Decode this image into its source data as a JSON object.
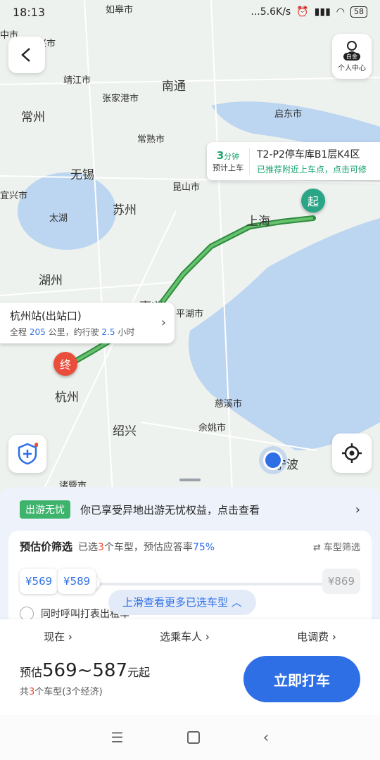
{
  "status": {
    "time": "18:13",
    "network": "...5.6K/s",
    "battery": "58"
  },
  "header": {
    "back_label": "<",
    "profile_badge": "白金",
    "profile_label": "个人中心"
  },
  "map": {
    "labels": [
      "如皋市",
      "中市",
      "泰兴市",
      "靖江市",
      "南通",
      "张家港市",
      "常州",
      "常熟市",
      "启东市",
      "无锡",
      "宜兴市",
      "昆山市",
      "苏州",
      "太湖",
      "上海",
      "湖州",
      "嘉兴",
      "平湖市",
      "杭州",
      "绍兴",
      "慈溪市",
      "余姚市",
      "诸暨市",
      "宁波"
    ],
    "start_marker": "起",
    "end_marker": "终"
  },
  "pickup": {
    "minutes": "3",
    "minutes_unit": "分钟",
    "eta_label": "预计上车",
    "location": "T2-P2停车库B1层K4区",
    "hint": "已推荐附近上车点，点击可修"
  },
  "destination": {
    "name": "杭州站(出站口)",
    "prefix": "全程",
    "distance": "205",
    "mid": "公里，约行驶",
    "hours": "2.5",
    "suffix": "小时"
  },
  "promo": {
    "tag": "出游无忧",
    "text": "你已享受异地出游无忧权益，点击查看"
  },
  "filter": {
    "title": "预估价筛选",
    "desc_prefix": "已选",
    "count": "3",
    "desc_mid": "个车型，预估应答率",
    "rate": "75%",
    "switch_label": "车型筛选",
    "pill_min": "¥569",
    "pill_cur": "¥589",
    "pill_max": "¥869",
    "more_label": "上滑查看更多已选车型",
    "checkbox_label": "同时呼叫打表出租车"
  },
  "options": {
    "time": "现在",
    "passenger": "选乘车人",
    "fee": "电调费"
  },
  "price": {
    "prefix": "预估",
    "range": "569~587",
    "suffix": "元起",
    "sub_prefix": "共",
    "sub_count": "3",
    "sub_suffix": "个车型(3个经济)"
  },
  "call_button": "立即打车",
  "route_progress": 0.55
}
